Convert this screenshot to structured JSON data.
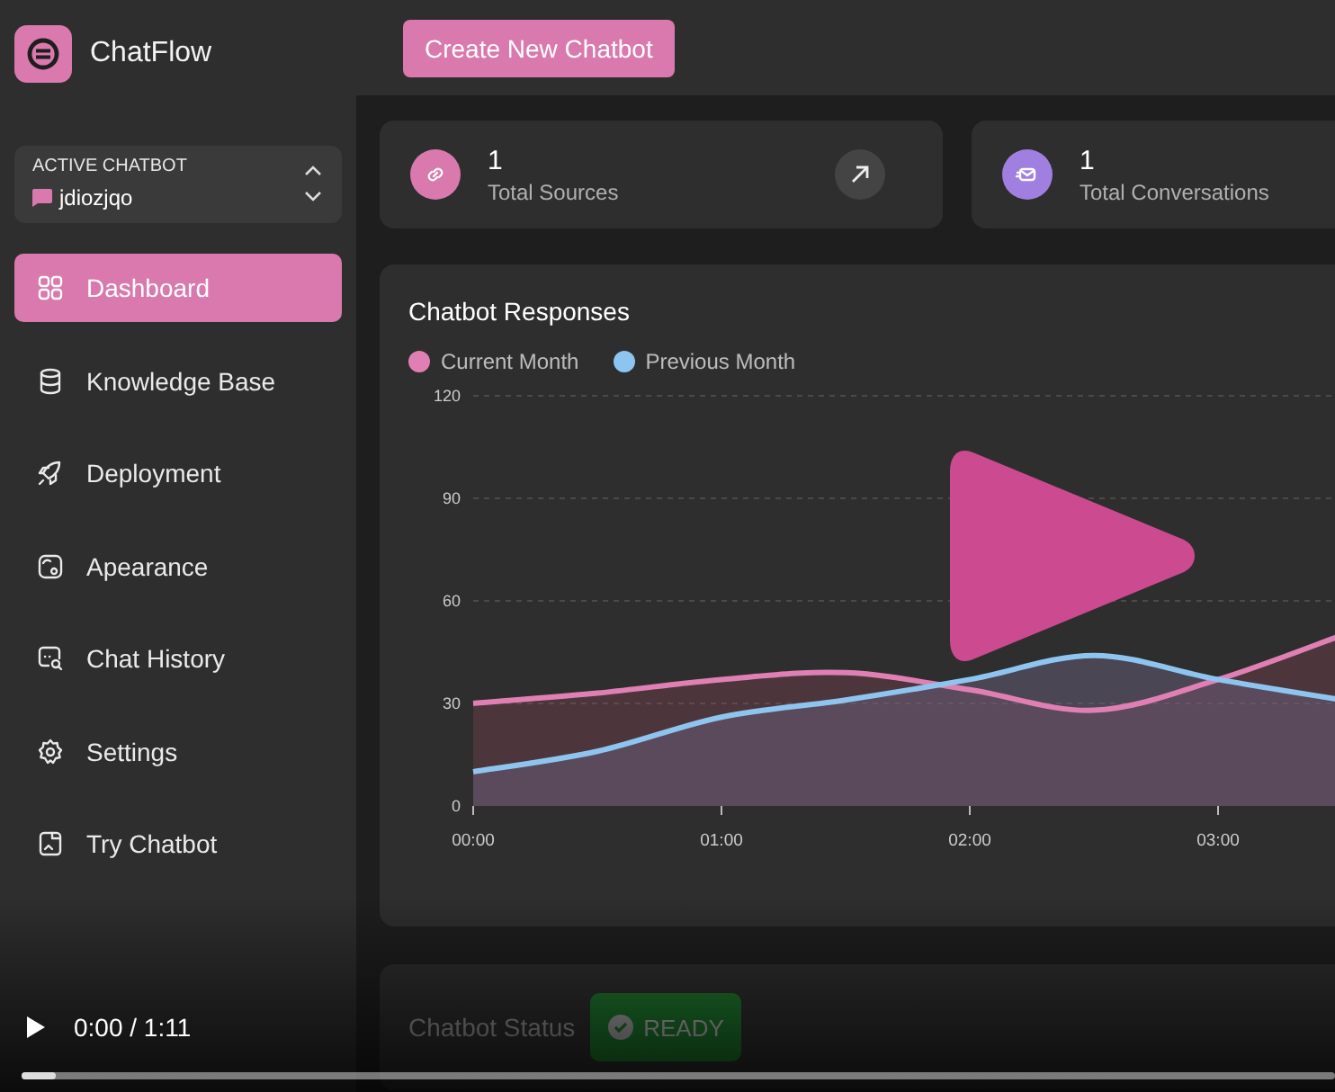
{
  "brand": {
    "name": "ChatFlow"
  },
  "active_chatbot": {
    "label": "ACTIVE CHATBOT",
    "name": "jdiozjqo"
  },
  "sidebar": {
    "items": [
      {
        "label": "Dashboard",
        "selected": true
      },
      {
        "label": "Knowledge Base",
        "selected": false
      },
      {
        "label": "Deployment",
        "selected": false
      },
      {
        "label": "Apearance",
        "selected": false
      },
      {
        "label": "Chat History",
        "selected": false
      },
      {
        "label": "Settings",
        "selected": false
      },
      {
        "label": "Try Chatbot",
        "selected": false
      }
    ]
  },
  "topbar": {
    "button": "Create New Chatbot"
  },
  "stats": [
    {
      "value": "1",
      "label": "Total Sources",
      "color": "#d979ae"
    },
    {
      "value": "1",
      "label": "Total Conversations",
      "color": "#a17fe0"
    }
  ],
  "chart": {
    "chart_data": {
      "type": "area",
      "title": "Chatbot Responses",
      "x": [
        0,
        0.5,
        1,
        1.5,
        2,
        2.5,
        3,
        3.5
      ],
      "series": [
        {
          "name": "Current Month",
          "color": "#e07fb4",
          "values": [
            30,
            33,
            37,
            39,
            34,
            28,
            37,
            50
          ]
        },
        {
          "name": "Previous Month",
          "color": "#8ec5f0",
          "values": [
            10,
            16,
            26,
            31,
            37,
            44,
            37,
            31
          ]
        }
      ],
      "xlim": [
        0,
        3.5
      ],
      "grid": true,
      "ylim": [
        0,
        120
      ],
      "yticks": [
        0,
        30,
        60,
        90,
        120
      ],
      "xticks": [
        {
          "value": 0,
          "label": "00:00"
        },
        {
          "value": 1,
          "label": "01:00"
        },
        {
          "value": 2,
          "label": "02:00"
        },
        {
          "value": 3,
          "label": "03:00"
        }
      ]
    }
  },
  "status": {
    "label": "Chatbot Status",
    "badge": "READY"
  },
  "video": {
    "time": "0:00 / 1:11",
    "level": 0.02
  }
}
